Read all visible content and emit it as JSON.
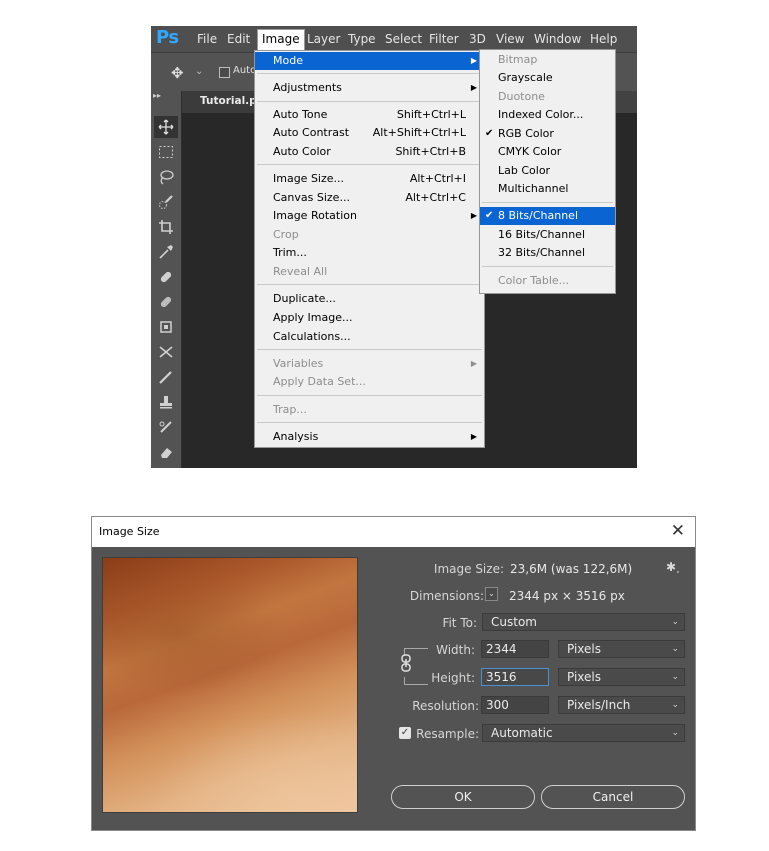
{
  "photoshop": {
    "logo": "Ps",
    "menubar": [
      "File",
      "Edit",
      "Image",
      "Layer",
      "Type",
      "Select",
      "Filter",
      "3D",
      "View",
      "Window",
      "Help"
    ],
    "options_bar": {
      "checkbox_label": "Auto"
    },
    "doc_tab": "Tutorial.ps",
    "image_menu": {
      "mode": "Mode",
      "adjustments": "Adjustments",
      "auto_tone": "Auto Tone",
      "auto_tone_sc": "Shift+Ctrl+L",
      "auto_contrast": "Auto Contrast",
      "auto_contrast_sc": "Alt+Shift+Ctrl+L",
      "auto_color": "Auto Color",
      "auto_color_sc": "Shift+Ctrl+B",
      "image_size": "Image Size...",
      "image_size_sc": "Alt+Ctrl+I",
      "canvas_size": "Canvas Size...",
      "canvas_size_sc": "Alt+Ctrl+C",
      "image_rotation": "Image Rotation",
      "crop": "Crop",
      "trim": "Trim...",
      "reveal_all": "Reveal All",
      "duplicate": "Duplicate...",
      "apply_image": "Apply Image...",
      "calculations": "Calculations...",
      "variables": "Variables",
      "apply_data_set": "Apply Data Set...",
      "trap": "Trap...",
      "analysis": "Analysis"
    },
    "mode_menu": {
      "bitmap": "Bitmap",
      "grayscale": "Grayscale",
      "duotone": "Duotone",
      "indexed": "Indexed Color...",
      "rgb": "RGB Color",
      "cmyk": "CMYK Color",
      "lab": "Lab Color",
      "multichannel": "Multichannel",
      "bits8": "8 Bits/Channel",
      "bits16": "16 Bits/Channel",
      "bits32": "32 Bits/Channel",
      "color_table": "Color Table..."
    }
  },
  "dialog": {
    "title": "Image Size",
    "close": "✕",
    "image_size_label": "Image Size:",
    "image_size_value": "23,6M (was 122,6M)",
    "dimensions_label": "Dimensions:",
    "dimensions_value": "2344 px  ×  3516 px",
    "fit_to_label": "Fit To:",
    "fit_to_value": "Custom",
    "width_label": "Width:",
    "width_value": "2344",
    "width_unit": "Pixels",
    "height_label": "Height:",
    "height_value": "3516",
    "height_unit": "Pixels",
    "resolution_label": "Resolution:",
    "resolution_value": "300",
    "resolution_unit": "Pixels/Inch",
    "resample_label": "Resample:",
    "resample_value": "Automatic",
    "ok": "OK",
    "cancel": "Cancel"
  }
}
